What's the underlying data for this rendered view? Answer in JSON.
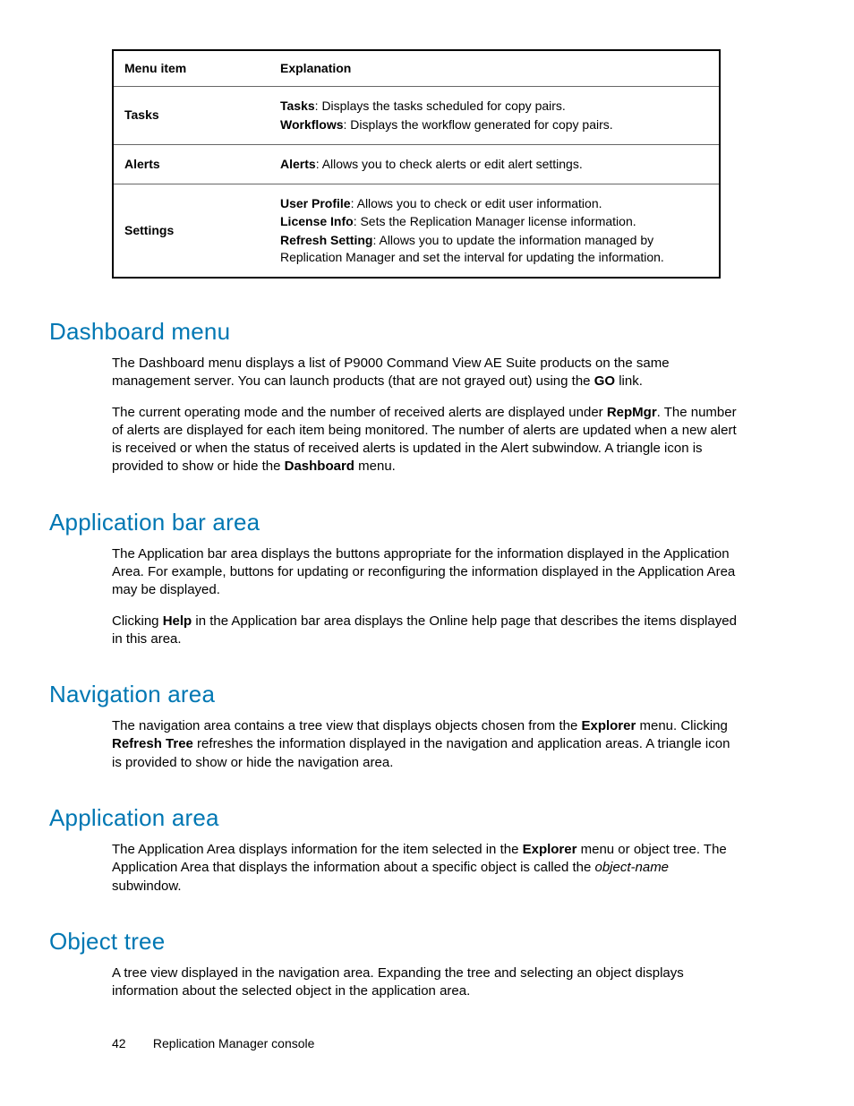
{
  "table": {
    "headers": {
      "menu": "Menu item",
      "exp": "Explanation"
    },
    "rows": [
      {
        "menu": "Tasks",
        "items": [
          {
            "term": "Tasks",
            "desc": ": Displays the tasks scheduled for copy pairs."
          },
          {
            "term": "Workflows",
            "desc": ": Displays the workflow generated for copy pairs."
          }
        ]
      },
      {
        "menu": "Alerts",
        "items": [
          {
            "term": "Alerts",
            "desc": ": Allows you to check alerts or edit alert settings."
          }
        ]
      },
      {
        "menu": "Settings",
        "items": [
          {
            "term": "User Profile",
            "desc": ": Allows you to check or edit user information."
          },
          {
            "term": "License Info",
            "desc": ": Sets the Replication Manager license information."
          },
          {
            "term": "Refresh Setting",
            "desc": ": Allows you to update the information managed by Replication Manager and set the interval for updating the information."
          }
        ]
      }
    ]
  },
  "sections": {
    "dashboard": {
      "title": "Dashboard menu",
      "p1a": "The Dashboard menu displays a list of P9000 Command View AE Suite products on the same management server.  You can launch products (that are not grayed out) using the ",
      "p1b": "GO",
      "p1c": " link.",
      "p2a": "The current operating mode and the number of received alerts are displayed under ",
      "p2b": "RepMgr",
      "p2c": ". The number of alerts are displayed for each item being monitored. The number of alerts are updated when a new alert is received or when the status of received alerts is updated in the Alert subwindow. A triangle icon is provided to show or hide the ",
      "p2d": "Dashboard",
      "p2e": " menu."
    },
    "appbar": {
      "title": "Application bar area",
      "p1": "The Application bar area displays the buttons appropriate for the information displayed in the Application Area. For example, buttons for updating or reconfiguring the information displayed in the Application Area may be displayed.",
      "p2a": "Clicking ",
      "p2b": "Help",
      "p2c": " in the Application bar area displays the Online help page that describes the items displayed in this area."
    },
    "nav": {
      "title": "Navigation area",
      "p1a": "The navigation area contains a tree view that displays objects chosen from the ",
      "p1b": "Explorer",
      "p1c": " menu. Clicking ",
      "p1d": "Refresh Tree",
      "p1e": " refreshes the information displayed in the navigation and application areas. A triangle icon is provided to show or hide the navigation area."
    },
    "apparea": {
      "title": "Application area",
      "p1a": "The Application Area displays information for the item selected in the ",
      "p1b": "Explorer",
      "p1c": " menu or object tree. The Application Area that displays the information about a specific object is called the ",
      "p1d": "object-name",
      "p1e": " subwindow."
    },
    "objtree": {
      "title": "Object tree",
      "p1": "A tree view displayed in the navigation area.  Expanding the tree and selecting an object displays information about the selected object in the application area."
    }
  },
  "footer": {
    "page": "42",
    "title": "Replication Manager console"
  }
}
